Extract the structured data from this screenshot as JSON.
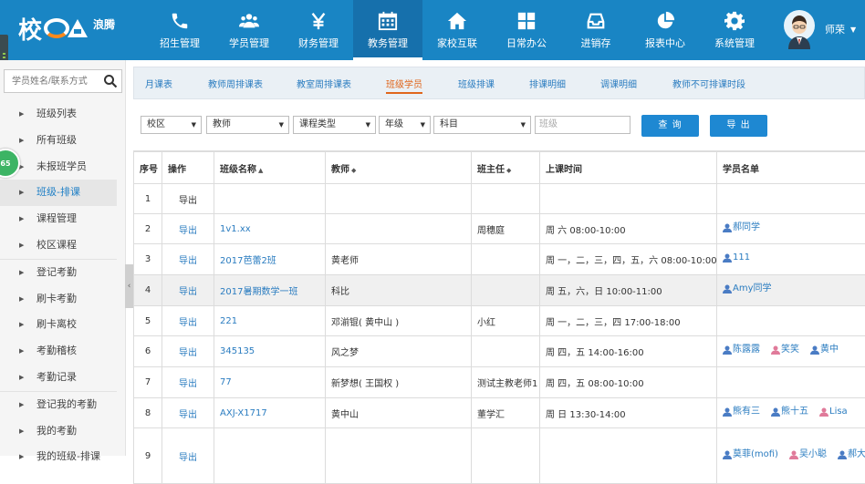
{
  "logo": {
    "char": "校",
    "sub": "浪腾"
  },
  "nav": [
    {
      "label": "招生管理",
      "icon": "phone-icon"
    },
    {
      "label": "学员管理",
      "icon": "users-icon"
    },
    {
      "label": "财务管理",
      "icon": "yen-icon"
    },
    {
      "label": "教务管理",
      "icon": "calendar-icon",
      "active": true
    },
    {
      "label": "家校互联",
      "icon": "home-icon"
    },
    {
      "label": "日常办公",
      "icon": "grid-icon"
    },
    {
      "label": "进销存",
      "icon": "inbox-icon"
    },
    {
      "label": "报表中心",
      "icon": "pie-chart-icon"
    },
    {
      "label": "系统管理",
      "icon": "gear-icon"
    }
  ],
  "user": {
    "name": "师荣"
  },
  "sidebar": {
    "search_placeholder": "学员姓名/联系方式",
    "items": [
      {
        "label": "班级列表"
      },
      {
        "label": "所有班级"
      },
      {
        "label": "未报班学员"
      },
      {
        "label": "班级-排课",
        "active": true
      },
      {
        "label": "课程管理"
      },
      {
        "label": "校区课程"
      },
      {
        "label": "登记考勤"
      },
      {
        "label": "刷卡考勤"
      },
      {
        "label": "刷卡离校"
      },
      {
        "label": "考勤稽核"
      },
      {
        "label": "考勤记录"
      },
      {
        "label": "登记我的考勤"
      },
      {
        "label": "我的考勤"
      },
      {
        "label": "我的班级-排课"
      }
    ],
    "badge": "65"
  },
  "subtabs": [
    "月课表",
    "教师周排课表",
    "教室周排课表",
    "班级学员",
    "班级排课",
    "排课明细",
    "调课明细",
    "教师不可排课时段"
  ],
  "subtab_active": 3,
  "filters": {
    "campus": "校区",
    "teacher": "教师",
    "course_type": "课程类型",
    "grade": "年级",
    "subject": "科目",
    "class_placeholder": "班级",
    "query_button": "查 询",
    "export_button": "导 出"
  },
  "table": {
    "headers": [
      "序号",
      "操作",
      "班级名称",
      "教师",
      "班主任",
      "上课时间",
      "学员名单"
    ],
    "rows": [
      {
        "no": "1",
        "op": "导出",
        "name": "",
        "teacher": "",
        "head": "",
        "time": "",
        "students": []
      },
      {
        "no": "2",
        "op": "导出",
        "name": "1v1.xx",
        "teacher": "",
        "head": "周穗庭",
        "time": "周 六 08:00-10:00",
        "students": [
          "郝同学"
        ]
      },
      {
        "no": "3",
        "op": "导出",
        "name": "2017芭蕾2班",
        "teacher": "黄老师",
        "head": "",
        "time": "周 一，二，三，四，五，六 08:00-10:00",
        "students": [
          "111"
        ]
      },
      {
        "no": "4",
        "op": "导出",
        "name": "2017暑期数学一班",
        "teacher": "科比",
        "head": "",
        "time": "周 五，六，日 10:00-11:00",
        "students": [
          "Amy同学"
        ]
      },
      {
        "no": "5",
        "op": "导出",
        "name": "221",
        "teacher": "邓湔锟( 黄中山 )",
        "head": "小红",
        "time": "周 一，二，三，四 17:00-18:00",
        "students": []
      },
      {
        "no": "6",
        "op": "导出",
        "name": "345135",
        "teacher": "风之梦",
        "head": "",
        "time": "周 四，五 14:00-16:00",
        "students": [
          "陈露露",
          "笑笑",
          "黄中"
        ]
      },
      {
        "no": "7",
        "op": "导出",
        "name": "77",
        "teacher": "新梦想( 王国权 )",
        "head": "测试主教老师1",
        "time": "周 四，五 08:00-10:00",
        "students": []
      },
      {
        "no": "8",
        "op": "导出",
        "name": "AXJ-X1717",
        "teacher": "黄中山",
        "head": "董学汇",
        "time": "周 日 13:30-14:00",
        "students": [
          "熊有三",
          "熊十五",
          "Lisa"
        ]
      },
      {
        "no": "9",
        "op": "导出",
        "name": "",
        "teacher": "",
        "head": "",
        "time": "",
        "students": [
          "莫菲(mofi)",
          "吴小聪",
          "郝大"
        ]
      }
    ]
  }
}
